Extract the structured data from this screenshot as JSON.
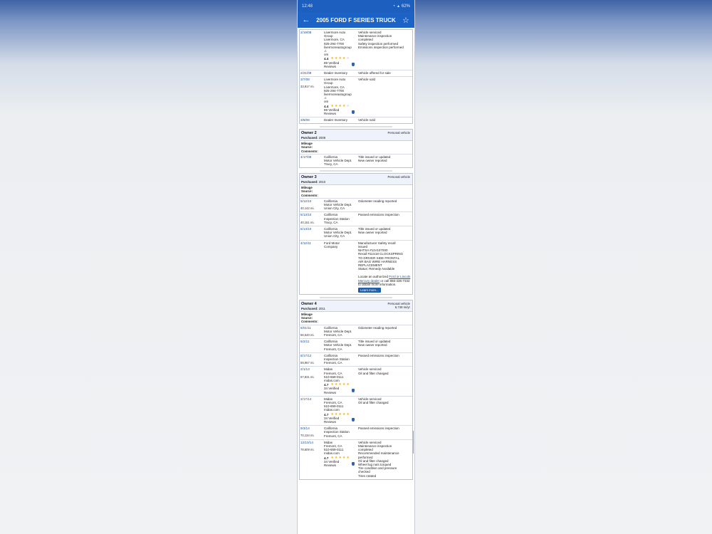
{
  "status_bar": {
    "time": "12:48",
    "battery": "62%"
  },
  "app_bar": {
    "title": "2005 FORD F SERIES TRUCK",
    "back_icon": "arrow-left-icon",
    "star_icon": "star-outline-icon"
  },
  "card1": {
    "rows": [
      {
        "date": "2/19/08",
        "mileage": "",
        "source": [
          "Livermore Auto",
          "Group",
          "Livermore, CA",
          "925-294-7700",
          "livermoreautogroup",
          ".c",
          "om"
        ],
        "rating": "4.4",
        "stars": 4,
        "reviews": [
          "89 Verified",
          "Reviews"
        ],
        "details": [
          "Vehicle serviced",
          "Maintenance inspection",
          "completed",
          "Safety inspection performed",
          "Emissions inspection performed"
        ]
      },
      {
        "date": "2/21/08",
        "mileage": "",
        "source": [
          "Dealer Inventory"
        ],
        "details": [
          "Vehicle offered for sale"
        ]
      },
      {
        "date": "3/7/08",
        "mileage": "33,917 mi.",
        "source": [
          "Livermore Auto",
          "Group",
          "Livermore, CA",
          "925-294-7700",
          "livermoreautogroup",
          ".c",
          "om"
        ],
        "rating": "4.4",
        "stars": 4,
        "reviews": [
          "89 Verified",
          "Reviews"
        ],
        "details": [
          "Vehicle sold"
        ]
      },
      {
        "date": "3/8/08",
        "mileage": "",
        "source": [
          "Dealer Inventory"
        ],
        "details": [
          "Vehicle sold"
        ]
      }
    ]
  },
  "owner2": {
    "title": "Owner 2",
    "purchased_label": "Purchased:",
    "purchased": "2008",
    "type": "Personal vehicle",
    "fields": [
      "Mileage",
      "Source:",
      "Comments:"
    ],
    "rows": [
      {
        "date": "4/17/08",
        "mileage": "",
        "source": [
          "California",
          "Motor Vehicle Dept.",
          "Tracy, CA"
        ],
        "details": [
          "Title issued or updated",
          "New owner reported"
        ]
      }
    ]
  },
  "owner3": {
    "title": "Owner 3",
    "purchased_label": "Purchased:",
    "purchased": "2010",
    "type": "Personal vehicle",
    "fields": [
      "Mileage",
      "Source:",
      "Comments:"
    ],
    "rows": [
      {
        "date": "5/12/10",
        "mileage": "40,142 mi.",
        "source": [
          "California",
          "Motor Vehicle Dept.",
          "Union City, CA"
        ],
        "details": [
          "Odometer reading reported"
        ]
      },
      {
        "date": "5/13/10",
        "mileage": "40,151 mi.",
        "source": [
          "California",
          "Inspection Station",
          "Tracy, CA"
        ],
        "details": [
          "Passed emissions inspection"
        ]
      },
      {
        "date": "5/13/10",
        "mileage": "",
        "source": [
          "California",
          "Motor Vehicle Dept.",
          "Union City, CA"
        ],
        "details": [
          "Title issued or updated",
          "New owner reported"
        ]
      }
    ],
    "recall": {
      "date": "4/12/11",
      "source": [
        "Ford Motor",
        "Company"
      ],
      "details": [
        "Manufacturer Safety recall",
        "issued",
        "NHTSA #11V107000",
        "Recall #11S18 CLOCKSPRING",
        "TO DRIVER SIDE FRONTAL",
        "AIR BAG WIRE HARNESS",
        "REPLACEMENT",
        "Status: Remedy Available"
      ],
      "locate_prefix": "Locate an authorized",
      "locate_link": "Ford or Lincoln Mercury dealer",
      "locate_suffix": "or call 866-436-7332 to obtain more information.",
      "learn_more": "Learn more..."
    }
  },
  "owner4": {
    "title": "Owner 4",
    "purchased_label": "Purchased:",
    "purchased": "2011",
    "type": "Personal vehicle",
    "miles_per_year": "6,748 mi/yr",
    "fields": [
      "Mileage",
      "Source:",
      "Comments:"
    ],
    "rows": [
      {
        "date": "6/01/11",
        "mileage": "56,540 mi.",
        "source": [
          "California",
          "Motor Vehicle Dept.",
          "Fremont, CA"
        ],
        "details": [
          "Odometer reading reported"
        ]
      },
      {
        "date": "6/2/11",
        "mileage": "",
        "source": [
          "California",
          "Motor Vehicle Dept.",
          "Fremont, CA"
        ],
        "details": [
          "Title issued or updated",
          "New owner reported"
        ]
      },
      {
        "date": "8/17/12",
        "mileage": "59,957 mi.",
        "source": [
          "California",
          "Inspection Station",
          "Fremont, CA"
        ],
        "details": [
          "Passed emissions inspection"
        ]
      },
      {
        "date": "2/1/13",
        "mileage": "67,831 mi.",
        "source": [
          "Midas",
          "Fremont, CA",
          "510-659-0111",
          "midas.com"
        ],
        "rating": "4.7",
        "stars": 5,
        "reviews": [
          "34 Verified",
          "Reviews"
        ],
        "details": [
          "Vehicle serviced",
          "Oil and filter changed"
        ]
      },
      {
        "date": "2/17/14",
        "mileage": "",
        "source": [
          "Midas",
          "Fremont, CA",
          "510-659-0111",
          "midas.com"
        ],
        "rating": "4.7",
        "stars": 5,
        "reviews": [
          "34 Verified",
          "Reviews"
        ],
        "details": [
          "Vehicle serviced",
          "Oil and filter changed"
        ]
      },
      {
        "date": "9/3/14",
        "mileage": "70,134 mi.",
        "source": [
          "California",
          "Inspection Station",
          "Fremont, CA"
        ],
        "details": [
          "Passed emissions inspection"
        ]
      },
      {
        "date": "12/10/14",
        "mileage": "78,609 mi.",
        "source": [
          "Midas",
          "Fremont, CA",
          "510-659-0111",
          "midas.com"
        ],
        "rating": "4.7",
        "stars": 5,
        "reviews": [
          "34 Verified",
          "Reviews"
        ],
        "details": [
          "Vehicle serviced",
          "Maintenance inspection",
          "completed",
          "Recommended maintenance",
          "performed",
          "Oil and filter changed",
          "Wheel lug nuts torqued",
          "Tire condition and pressure",
          "checked",
          "Tires rotated"
        ]
      }
    ]
  }
}
